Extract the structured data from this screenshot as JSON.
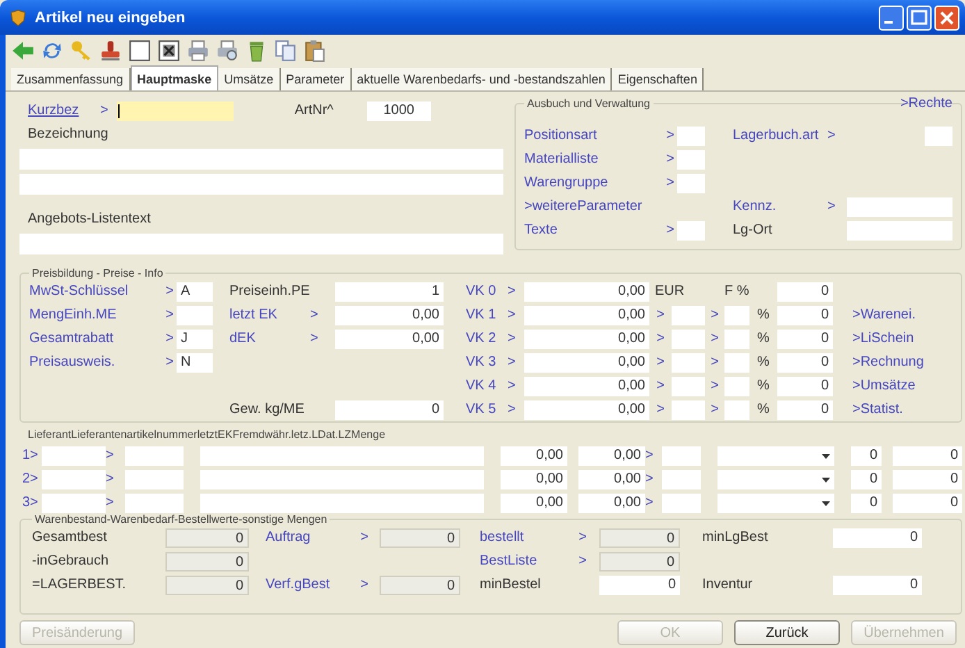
{
  "window": {
    "title": "Artikel neu eingeben"
  },
  "tabs": [
    {
      "label": "Zusammenfassung",
      "selected": false
    },
    {
      "label": "Hauptmaske",
      "selected": true
    },
    {
      "label": "Umsätze",
      "selected": false
    },
    {
      "label": "Parameter",
      "selected": false
    },
    {
      "label": "aktuelle Warenbedarfs- und -bestandszahlen",
      "selected": false
    },
    {
      "label": "Eigenschaften",
      "selected": false
    }
  ],
  "head": {
    "kurzbez": {
      "text": "Kurzbez",
      "kind": "hyperlink"
    },
    "kurzbez_arrow": ">",
    "focused": true,
    "artnr": {
      "text": "ArtNr^",
      "kind": "text"
    },
    "artnr_value": "1000",
    "bezeichnung": {
      "text": "Bezeichnung",
      "kind": "text"
    },
    "listentext": {
      "text": "Angebots-Listentext",
      "kind": "text"
    }
  },
  "verwaltung": {
    "title": "Ausbuch und Verwaltung",
    "rechte": {
      "text": ">Rechte",
      "kind": "link"
    },
    "left": [
      {
        "label": {
          "text": "Positionsart",
          "kind": "link"
        },
        "arrow": ">"
      },
      {
        "label": {
          "text": "Materialliste",
          "kind": "link"
        },
        "arrow": ">"
      },
      {
        "label": {
          "text": "Warengruppe",
          "kind": "link"
        },
        "arrow": ">"
      },
      {
        "label": {
          "text": ">weitereParameter",
          "kind": "link"
        }
      },
      {
        "label": {
          "text": "Texte",
          "kind": "link"
        },
        "arrow": ">"
      }
    ],
    "right": [
      {
        "label": {
          "text": "Lagerbuch.art",
          "kind": "link"
        },
        "arrow": ">"
      },
      {
        "label": {
          "text": "Kennz.",
          "kind": "link"
        },
        "arrow": ">"
      },
      {
        "label": {
          "text": "Lg-Ort",
          "kind": "text"
        }
      }
    ]
  },
  "pricing": {
    "title": "Preisbildung - Preise - Info",
    "rows": [
      {
        "left": {
          "label": {
            "text": "MwSt-Schlüssel",
            "kind": "link"
          },
          "arrow": ">",
          "value": "A"
        },
        "mid": {
          "label": {
            "text": "Preiseinh.PE",
            "kind": "text"
          },
          "value": "1"
        },
        "vk": {
          "kind": "head",
          "label": "VK 0",
          "arrow": ">",
          "value": "0,00",
          "currency": "EUR",
          "factor": "F %",
          "percent_value": "0"
        }
      },
      {
        "left": {
          "label": {
            "text": "MengEinh.ME",
            "kind": "link"
          },
          "arrow": ">"
        },
        "mid": {
          "label": {
            "text": "letzt EK",
            "kind": "link"
          },
          "arrow": ">",
          "value": "0,00"
        },
        "vk": {
          "kind": "rate",
          "label": "VK 1",
          "arrow": ">",
          "value": "0,00",
          "arrow2": ">",
          "arrow3": ">",
          "percent": "%",
          "percent_value": "0"
        },
        "link": ">Warenei."
      },
      {
        "left": {
          "label": {
            "text": "Gesamtrabatt",
            "kind": "link"
          },
          "arrow": ">",
          "value": "J"
        },
        "mid": {
          "label": {
            "text": "dEK",
            "kind": "link"
          },
          "arrow": ">",
          "value": "0,00"
        },
        "vk": {
          "kind": "rate",
          "label": "VK 2",
          "arrow": ">",
          "value": "0,00",
          "arrow2": ">",
          "arrow3": ">",
          "percent": "%",
          "percent_value": "0"
        },
        "link": ">LiSchein"
      },
      {
        "left": {
          "label": {
            "text": "Preisausweis.",
            "kind": "link"
          },
          "arrow": ">",
          "value": "N"
        },
        "vk": {
          "kind": "rate",
          "label": "VK 3",
          "arrow": ">",
          "value": "0,00",
          "arrow2": ">",
          "arrow3": ">",
          "percent": "%",
          "percent_value": "0"
        },
        "link": ">Rechnung"
      },
      {
        "vk": {
          "kind": "rate",
          "label": "VK 4",
          "arrow": ">",
          "value": "0,00",
          "arrow2": ">",
          "arrow3": ">",
          "percent": "%",
          "percent_value": "0"
        },
        "link": ">Umsätze"
      },
      {
        "mid": {
          "label": {
            "text": "Gew. kg/ME",
            "kind": "text"
          },
          "value": "0"
        },
        "vk": {
          "kind": "rate",
          "label": "VK 5",
          "arrow": ">",
          "value": "0,00",
          "arrow2": ">",
          "arrow3": ">",
          "percent": "%",
          "percent_value": "0"
        },
        "link": ">Statist."
      }
    ]
  },
  "suppliers": {
    "header": "LieferantLieferantenartikelnummerletztEKFremdwähr.letz.LDat.LZMenge",
    "rows": [
      {
        "number": "1>",
        "arrow": ">",
        "ek": "0,00",
        "foreign": "0,00",
        "arrow2": ">",
        "qty1": "0",
        "qty2": "0"
      },
      {
        "number": "2>",
        "arrow": ">",
        "ek": "0,00",
        "foreign": "0,00",
        "arrow2": ">",
        "qty1": "0",
        "qty2": "0"
      },
      {
        "number": "3>",
        "arrow": ">",
        "ek": "0,00",
        "foreign": "0,00",
        "arrow2": ">",
        "qty1": "0",
        "qty2": "0"
      }
    ]
  },
  "stock": {
    "title": "Warenbestand-Warenbedarf-Bestellwerte-sonstige Mengen",
    "cells": [
      {
        "label": {
          "text": "Gesamtbest",
          "kind": "text"
        },
        "value": "0",
        "readonly": true
      },
      {
        "label": {
          "text": "Auftrag",
          "kind": "link"
        },
        "arrow": ">",
        "value": "0",
        "readonly": true
      },
      {
        "label": {
          "text": "bestellt",
          "kind": "link"
        },
        "arrow": ">",
        "value": "0",
        "readonly": true
      },
      {
        "label": {
          "text": "minLgBest",
          "kind": "text"
        },
        "value": "0",
        "readonly": false
      },
      {
        "label": {
          "text": "-inGebrauch",
          "kind": "text"
        },
        "value": "0",
        "readonly": true
      },
      {
        "label": {
          "text": "BestListe",
          "kind": "link"
        },
        "arrow": ">",
        "value": "0",
        "readonly": true
      },
      {
        "label": {
          "text": "=LAGERBEST.",
          "kind": "text"
        },
        "value": "0",
        "readonly": true
      },
      {
        "label": {
          "text": "Verf.gBest",
          "kind": "link"
        },
        "arrow": ">",
        "value": "0",
        "readonly": true
      },
      {
        "label": {
          "text": "minBestel",
          "kind": "text"
        },
        "value": "0",
        "readonly": false
      },
      {
        "label": {
          "text": "Inventur",
          "kind": "text"
        },
        "value": "0",
        "readonly": false
      }
    ]
  },
  "buttons": [
    {
      "label": "Preisänderung",
      "disabled": true
    },
    {
      "label": "OK",
      "disabled": true
    },
    {
      "label": "Zurück",
      "disabled": false
    },
    {
      "label": "Übernehmen",
      "disabled": true
    }
  ]
}
